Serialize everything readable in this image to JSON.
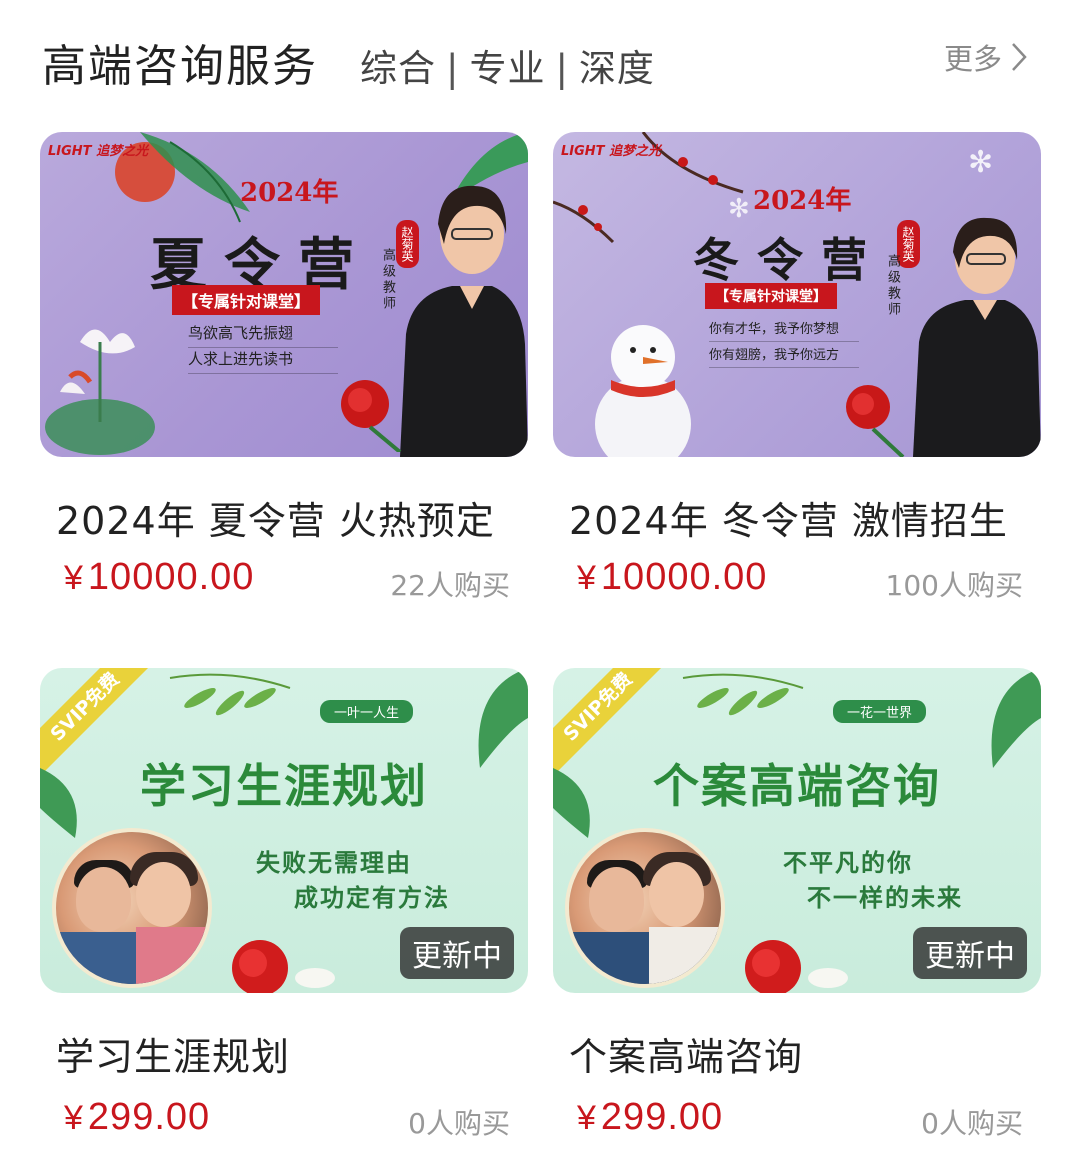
{
  "header": {
    "title": "高端咨询服务",
    "subtitle_parts": [
      "综合",
      "专业",
      "深度"
    ],
    "separator": "|",
    "more_label": "更多"
  },
  "cards": [
    {
      "name": "2024年 夏令营 火热预定",
      "currency": "¥",
      "price": "10000.00",
      "buyers": "22人购买",
      "poster": {
        "logo": "LIGHT 追梦之光",
        "year": "2024年",
        "headline": "夏令营",
        "ribbon": "【专属针对课堂】",
        "line1": "鸟欲高飞先振翅",
        "line2": "人求上进先读书",
        "teacher_name": "赵菊英",
        "teacher_title": "高级教师"
      }
    },
    {
      "name": "2024年 冬令营 激情招生",
      "currency": "¥",
      "price": "10000.00",
      "buyers": "100人购买",
      "poster": {
        "logo": "LIGHT 追梦之光",
        "year": "2024年",
        "headline": "冬令营",
        "ribbon": "【专属针对课堂】",
        "line1": "你有才华，我予你梦想",
        "line2": "你有翅膀，我予你远方",
        "teacher_name": "赵菊英",
        "teacher_title": "高级教师"
      }
    },
    {
      "name": "学习生涯规划",
      "currency": "¥",
      "price": "299.00",
      "buyers": "0人购买",
      "poster": {
        "corner": "SVIP免费",
        "motto": "一叶一人生",
        "headline": "学习生涯规划",
        "line1": "失败无需理由",
        "line2": "成功定有方法",
        "badge": "更新中"
      }
    },
    {
      "name": "个案高端咨询",
      "currency": "¥",
      "price": "299.00",
      "buyers": "0人购买",
      "poster": {
        "corner": "SVIP免费",
        "motto": "一花一世界",
        "headline": "个案高端咨询",
        "line1": "不平凡的你",
        "line2": "不一样的未来",
        "badge": "更新中"
      }
    }
  ],
  "colors": {
    "price": "#c8161d",
    "buyers": "#999999",
    "poster_purple": "#a996d4",
    "poster_green": "#c9ecdc",
    "accent_green": "#2b8a3a"
  },
  "icons": [
    "chevron-right-icon"
  ]
}
